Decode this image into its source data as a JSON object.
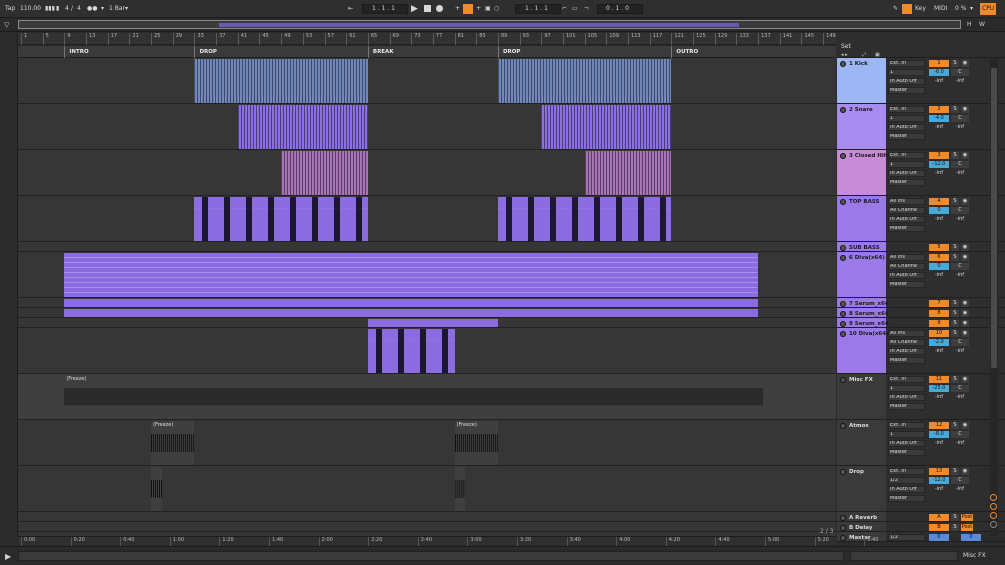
{
  "transport": {
    "tap": "Tap",
    "tempo": "110.00",
    "sig_num": "4",
    "sig_sep": "/",
    "sig_den": "4",
    "quantize": "1 Bar",
    "pos1": "1 .   1 .   1",
    "pos2": "1 .   1 .   1",
    "pos3": "0 .   1 .   0",
    "key": "Key",
    "midi": "MIDI",
    "cpu_pct": "0 %",
    "cpu": "CPU",
    "hw_h": "H",
    "hw_w": "W"
  },
  "ruler": [
    "1",
    "5",
    "9",
    "13",
    "17",
    "21",
    "25",
    "29",
    "33",
    "37",
    "41",
    "45",
    "49",
    "53",
    "57",
    "61",
    "65",
    "69",
    "73",
    "77",
    "81",
    "85",
    "89",
    "93",
    "97",
    "101",
    "105",
    "109",
    "113",
    "117",
    "121",
    "125",
    "129",
    "133",
    "137",
    "141",
    "145",
    "149"
  ],
  "locators": [
    {
      "label": "INTRO"
    },
    {
      "label": "DROP"
    },
    {
      "label": "BREAK"
    },
    {
      "label": "DROP"
    },
    {
      "label": "OUTRO"
    }
  ],
  "set_label": "Set",
  "time_ruler": [
    "0:00",
    "0:20",
    "0:40",
    "1:00",
    "1:20",
    "1:40",
    "2:00",
    "2:20",
    "2:40",
    "3:00",
    "3:20",
    "3:40",
    "4:00",
    "4:20",
    "4:40",
    "5:00",
    "5:20",
    "5:40"
  ],
  "page_indicator": "2 / 3",
  "status_track": "Misc FX",
  "freeze_label": "(Freeze)",
  "tracks": [
    {
      "name": "1 Kick",
      "color": "#9db7f5",
      "input": "Ext. In",
      "channel": "1",
      "monitor": "In  Auto  Off",
      "output": "Master",
      "num": "1",
      "vol": "-6.0",
      "pan": "C",
      "peak_l": "-inf",
      "peak_r": "-inf",
      "solo": "S"
    },
    {
      "name": "2 Snare",
      "color": "#a98cf0",
      "input": "Ext. In",
      "channel": "1",
      "monitor": "In  Auto  Off",
      "output": "Master",
      "num": "2",
      "vol": "-4.0",
      "pan": "C",
      "peak_l": "-inf",
      "peak_r": "-inf",
      "solo": "S"
    },
    {
      "name": "3 Closed Hih",
      "color": "#c88bd6",
      "input": "Ext. In",
      "channel": "1",
      "monitor": "In  Auto  Off",
      "output": "Master",
      "num": "3",
      "vol": "-12.0",
      "pan": "C",
      "peak_l": "-inf",
      "peak_r": "-inf",
      "solo": "S"
    },
    {
      "name": "TOP BASS",
      "color": "#9b7ae8",
      "input": "All Ins",
      "channel": "All Channe",
      "monitor": "In  Auto  Off",
      "output": "Master",
      "num": "4",
      "vol": "0",
      "pan": "C",
      "peak_l": "-inf",
      "peak_r": "-inf",
      "solo": "S"
    },
    {
      "name": "SUB BASS",
      "color": "#9b7ae8",
      "num": "5",
      "solo": "S"
    },
    {
      "name": "6 Diva(x64)",
      "color": "#9b7ae8",
      "input": "All Ins",
      "channel": "All Channe",
      "monitor": "In  Auto  Off",
      "output": "Master",
      "num": "6",
      "vol": "0",
      "pan": "C",
      "peak_l": "-inf",
      "peak_r": "-inf",
      "solo": "S"
    },
    {
      "name": "7 Serum_x64",
      "color": "#9b7ae8",
      "num": "7",
      "solo": "S"
    },
    {
      "name": "8 Serum_x64",
      "color": "#9b7ae8",
      "num": "8",
      "solo": "S"
    },
    {
      "name": "9 Serum_x64",
      "color": "#9b7ae8",
      "num": "9",
      "solo": "S"
    },
    {
      "name": "10 Diva(x64)",
      "color": "#9b7ae8",
      "input": "All Ins",
      "channel": "All Channe",
      "monitor": "In  Auto  Off",
      "output": "Master",
      "num": "10",
      "vol": "-2.0",
      "pan": "C",
      "peak_l": "-inf",
      "peak_r": "-inf",
      "solo": "S"
    },
    {
      "name": "Misc FX",
      "color": "#3a3a3a",
      "input": "Ext. In",
      "channel": "1",
      "monitor": "In  Auto  Off",
      "output": "Master",
      "num": "11",
      "vol": "-25.0",
      "pan": "C",
      "peak_l": "-inf",
      "peak_r": "-inf",
      "solo": "S"
    },
    {
      "name": "Atmos",
      "color": "#3a3a3a",
      "input": "Ext. In",
      "channel": "1",
      "monitor": "In  Auto  Off",
      "output": "Master",
      "num": "12",
      "vol": "-8.0",
      "pan": "C",
      "peak_l": "-inf",
      "peak_r": "-inf",
      "solo": "S"
    },
    {
      "name": "Drop",
      "color": "#3a3a3a",
      "input": "Ext. In",
      "channel": "1/2",
      "monitor": "In  Auto  Off",
      "output": "Master",
      "num": "13",
      "vol": "-12.0",
      "pan": "C",
      "peak_l": "-inf",
      "peak_r": "-inf",
      "solo": "S"
    },
    {
      "name": "A Reverb",
      "color": "#3a3a3a",
      "num": "A",
      "solo": "S",
      "post": "Post"
    },
    {
      "name": "B Delay",
      "color": "#3a3a3a",
      "num": "B",
      "solo": "S",
      "post": "Post"
    },
    {
      "name": "Master",
      "color": "#3a3a3a",
      "input": "1/2",
      "num": "0",
      "vol": "0"
    }
  ]
}
